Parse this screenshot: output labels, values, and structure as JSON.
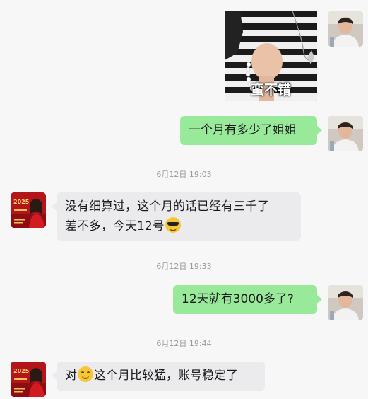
{
  "messages": {
    "sticker_caption": "蛮不错",
    "msg1": "一个月有多少了姐姐",
    "time1": "6月12日 19:03",
    "msg2_line1": "没有细算过，这个月的话已经有三千了",
    "msg2_line2": "差不多，今天12号",
    "msg2_emoji": "sunglasses-emoji",
    "time2": "6月12日 19:33",
    "msg3": "12天就有3000多了?",
    "time3": "6月12日 19:44",
    "msg4_pre": "对",
    "msg4_emoji": "smile-emoji",
    "msg4_post": "这个月比较猛，账号稳定了"
  },
  "avatars": {
    "other_badge": "2025"
  },
  "colors": {
    "background": "#f7f7f8",
    "my_bubble": "#98e99a",
    "other_bubble": "#ebebed",
    "timestamp": "#9a9a9a"
  }
}
